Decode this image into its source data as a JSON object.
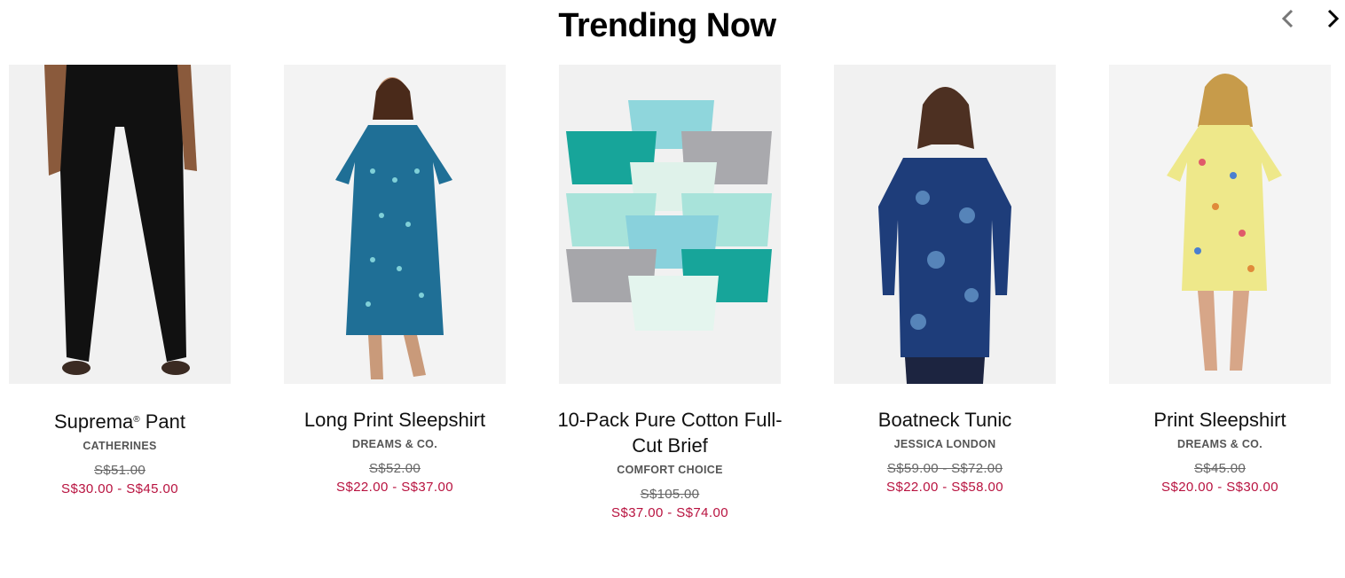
{
  "header": {
    "title": "Trending Now"
  },
  "carousel": {
    "prev_icon": "chevron-left-icon",
    "next_icon": "chevron-right-icon"
  },
  "products": [
    {
      "name": "Suprema",
      "name_suffix": "®",
      "name_rest": " Pant",
      "brand": "CATHERINES",
      "was_price": "S$51.00",
      "price": "S$30.00 - S$45.00"
    },
    {
      "name": "Long Print Sleepshirt",
      "brand": "DREAMS & CO.",
      "was_price": "S$52.00",
      "price": "S$22.00 - S$37.00"
    },
    {
      "name": "10-Pack Pure Cotton Full-Cut Brief",
      "brand": "COMFORT CHOICE",
      "was_price": "S$105.00",
      "price": "S$37.00 - S$74.00"
    },
    {
      "name": "Boatneck Tunic",
      "brand": "JESSICA LONDON",
      "was_price": "S$59.00 - S$72.00",
      "price": "S$22.00 - S$58.00"
    },
    {
      "name": "Print Sleepshirt",
      "brand": "DREAMS & CO.",
      "was_price": "S$45.00",
      "price": "S$20.00 - S$30.00"
    }
  ],
  "colors": {
    "sale": "#b8123f",
    "image_bg": "#f1f1f1",
    "title": "#000000"
  }
}
